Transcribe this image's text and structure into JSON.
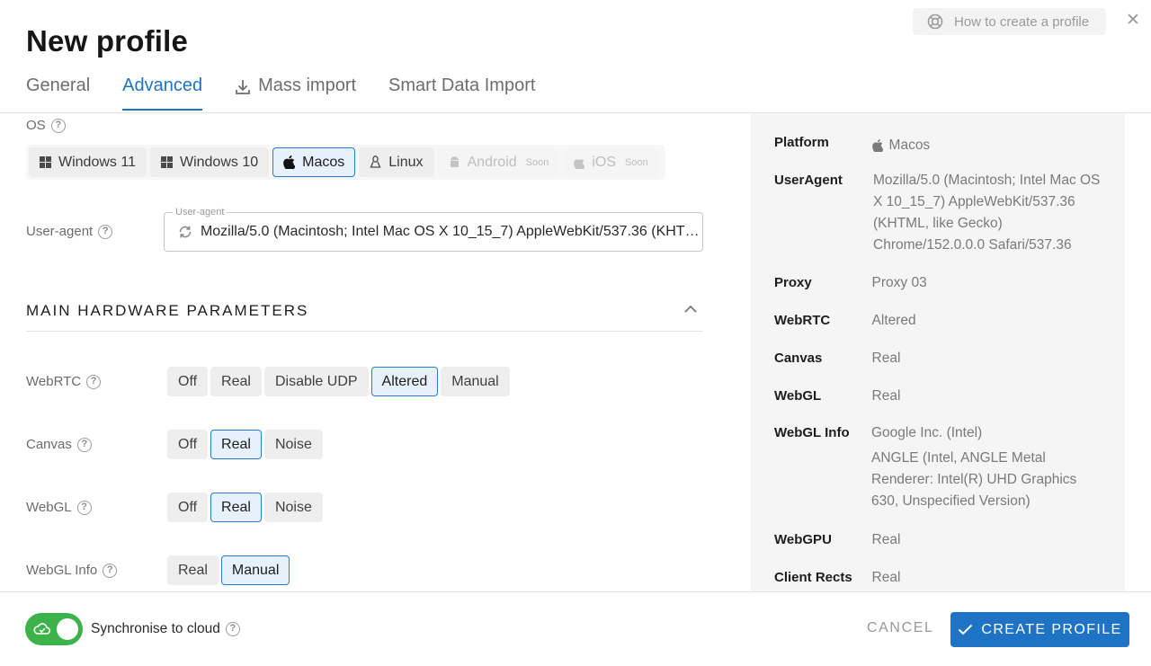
{
  "header": {
    "title": "New profile",
    "help_link": "How to create a profile",
    "close": "✕"
  },
  "tabs": [
    {
      "label": "General",
      "active": false
    },
    {
      "label": "Advanced",
      "active": true
    },
    {
      "label": "Mass import",
      "active": false,
      "icon": "download-icon"
    },
    {
      "label": "Smart Data Import",
      "active": false
    }
  ],
  "os": {
    "label": "OS",
    "options": [
      {
        "label": "Windows 11",
        "icon": "windows-icon",
        "state": "normal"
      },
      {
        "label": "Windows 10",
        "icon": "windows-icon",
        "state": "normal"
      },
      {
        "label": "Macos",
        "icon": "apple-icon",
        "state": "selected"
      },
      {
        "label": "Linux",
        "icon": "linux-icon",
        "state": "normal"
      },
      {
        "label": "Android",
        "icon": "android-icon",
        "state": "disabled",
        "badge": "Soon"
      },
      {
        "label": "iOS",
        "icon": "apple-icon",
        "state": "disabled",
        "badge": "Soon"
      }
    ]
  },
  "user_agent": {
    "label": "User-agent",
    "field_legend": "User-agent",
    "value": "Mozilla/5.0 (Macintosh; Intel Mac OS X 10_15_7) AppleWebKit/537.36 (KHTML…"
  },
  "hardware": {
    "title": "MAIN HARDWARE PARAMETERS",
    "rows": [
      {
        "label": "WebRTC",
        "options": [
          "Off",
          "Real",
          "Disable UDP",
          "Altered",
          "Manual"
        ],
        "selected": "Altered"
      },
      {
        "label": "Canvas",
        "options": [
          "Off",
          "Real",
          "Noise"
        ],
        "selected": "Real"
      },
      {
        "label": "WebGL",
        "options": [
          "Off",
          "Real",
          "Noise"
        ],
        "selected": "Real"
      },
      {
        "label": "WebGL Info",
        "options": [
          "Real",
          "Manual"
        ],
        "selected": "Manual"
      }
    ]
  },
  "summary": {
    "rows": [
      {
        "key": "Platform",
        "value": "Macos"
      },
      {
        "key": "UserAgent",
        "value": "Mozilla/5.0 (Macintosh; Intel Mac OS X 10_15_7) AppleWebKit/537.36 (KHTML, like Gecko) Chrome/152.0.0.0 Safari/537.36"
      },
      {
        "key": "Proxy",
        "value": "Proxy 03"
      },
      {
        "key": "WebRTC",
        "value": "Altered"
      },
      {
        "key": "Canvas",
        "value": "Real"
      },
      {
        "key": "WebGL",
        "value": "Real"
      },
      {
        "key": "WebGL Info",
        "value": "Google Inc. (Intel)",
        "value2": "ANGLE (Intel, ANGLE Metal Renderer: Intel(R) UHD Graphics 630, Unspecified Version)"
      },
      {
        "key": "WebGPU",
        "value": "Real"
      },
      {
        "key": "Client Rects",
        "value": "Real"
      }
    ]
  },
  "footer": {
    "sync_label": "Synchronise to cloud",
    "sync_on": true,
    "cancel_label": "CANCEL",
    "create_label": "CREATE PROFILE"
  },
  "colors": {
    "accent": "#1e73c5",
    "toggle_on": "#3cb34a",
    "selected_bg": "#e7f1fb"
  }
}
